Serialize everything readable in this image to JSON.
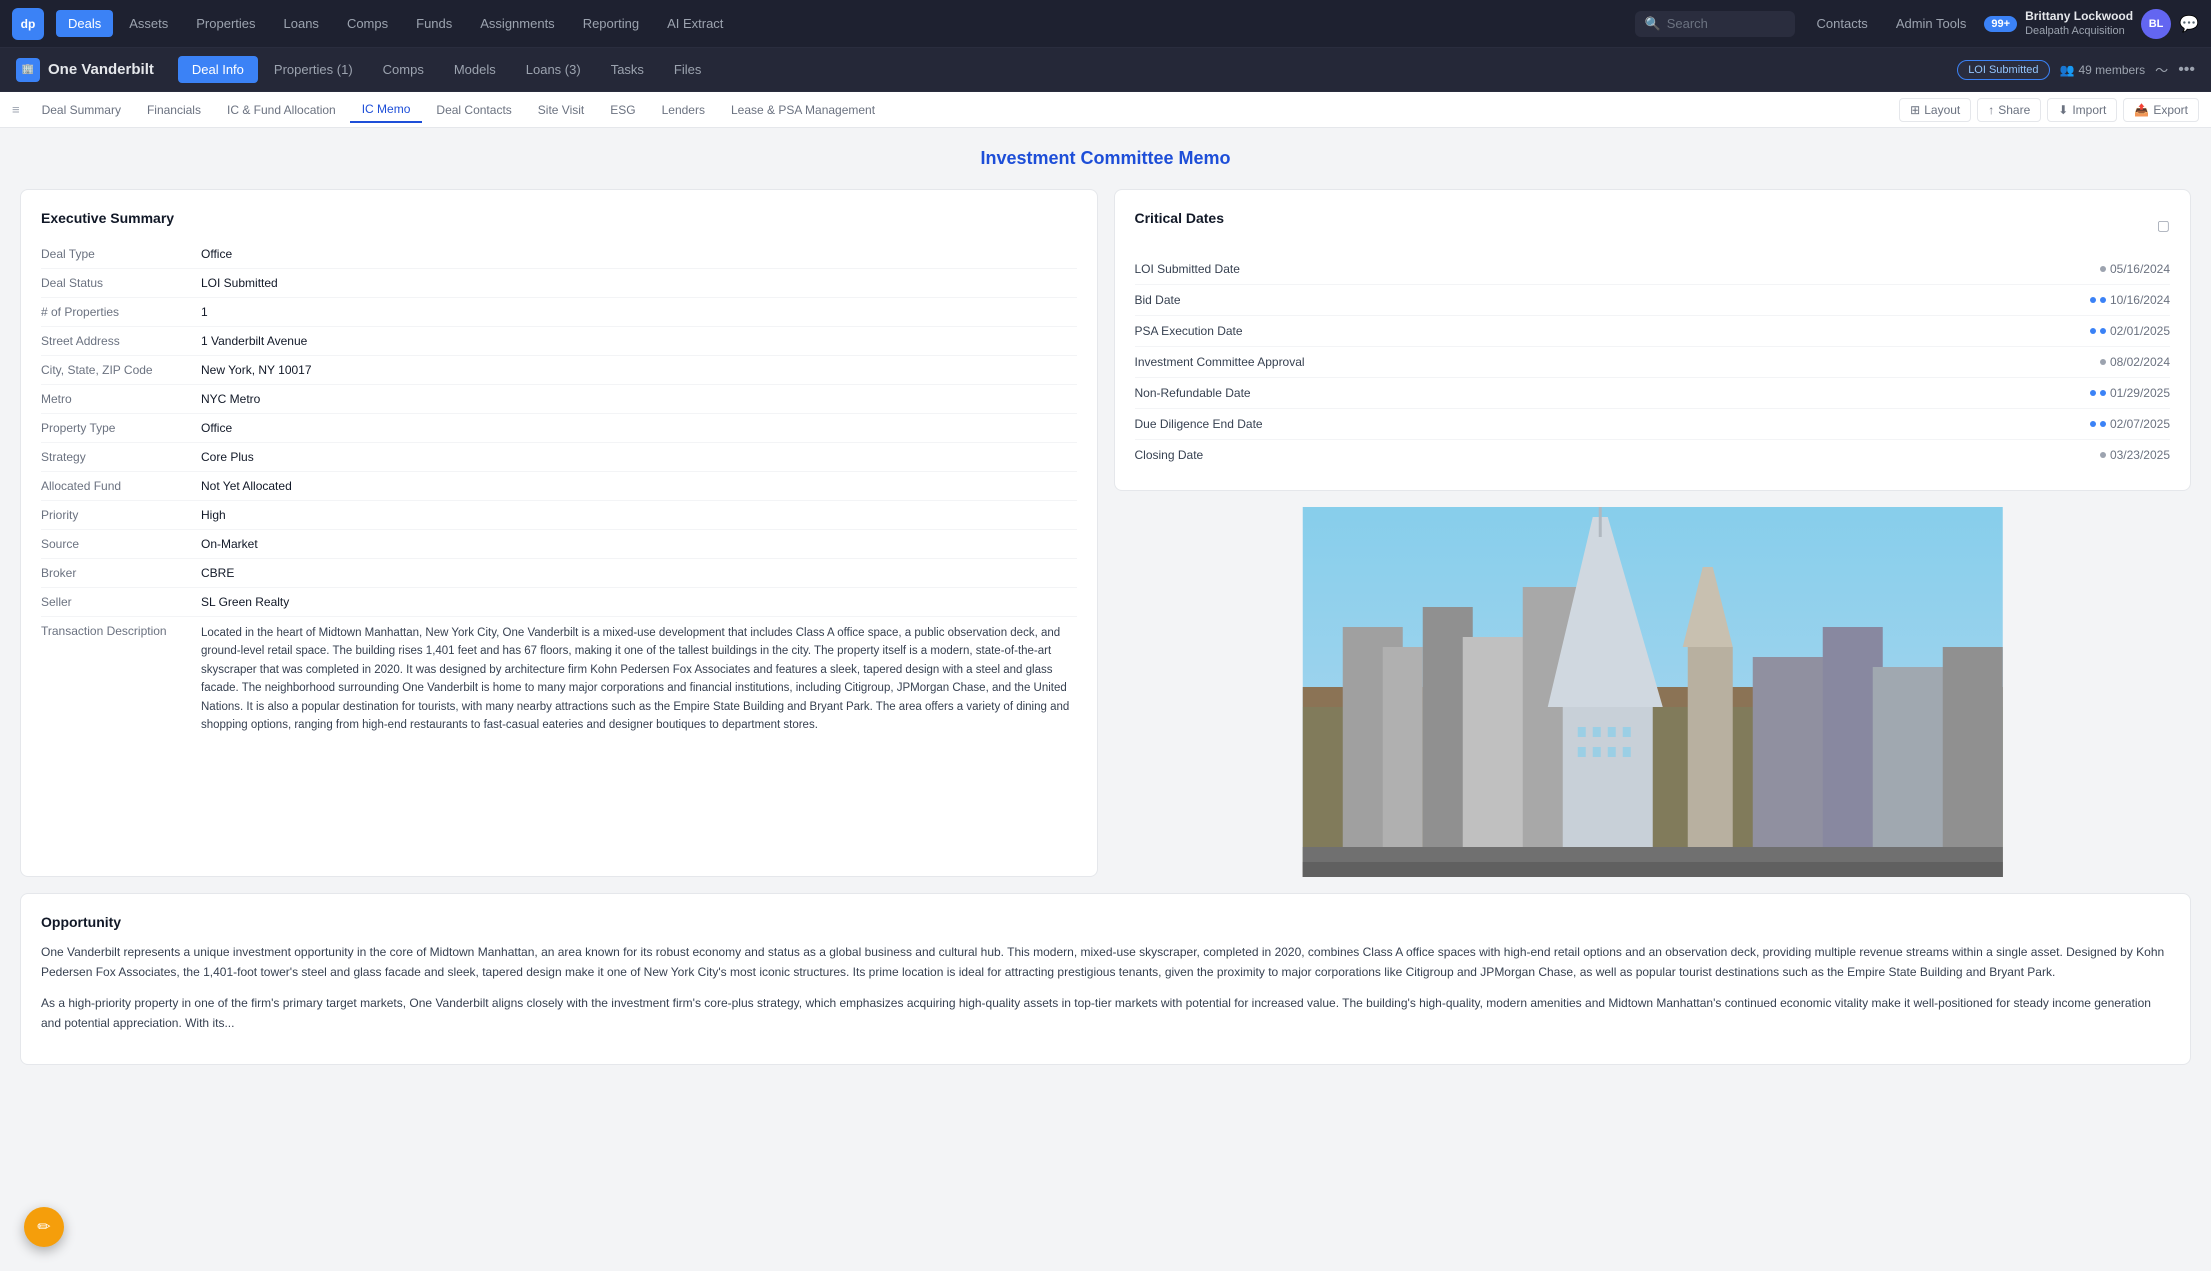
{
  "app": {
    "logo": "dp",
    "nav_items": [
      {
        "label": "Deals",
        "active": true
      },
      {
        "label": "Assets",
        "active": false
      },
      {
        "label": "Properties",
        "active": false
      },
      {
        "label": "Loans",
        "active": false
      },
      {
        "label": "Comps",
        "active": false
      },
      {
        "label": "Funds",
        "active": false
      },
      {
        "label": "Assignments",
        "active": false
      },
      {
        "label": "Reporting",
        "active": false
      },
      {
        "label": "AI Extract",
        "active": false
      }
    ],
    "search_placeholder": "Search",
    "contacts_label": "Contacts",
    "admin_tools_label": "Admin Tools",
    "notification_count": "99+",
    "user": {
      "name": "Brittany Lockwood",
      "company": "Dealpath Acquisition",
      "initials": "BL"
    }
  },
  "deal": {
    "title": "One Vanderbilt",
    "icon": "🏢",
    "status": "LOI Submitted",
    "members_count": "49 members",
    "tabs": [
      {
        "label": "Deal Info",
        "active": true
      },
      {
        "label": "Properties (1)",
        "active": false
      },
      {
        "label": "Comps",
        "active": false
      },
      {
        "label": "Models",
        "active": false
      },
      {
        "label": "Loans (3)",
        "active": false
      },
      {
        "label": "Tasks",
        "active": false
      },
      {
        "label": "Files",
        "active": false
      }
    ]
  },
  "sub_nav": {
    "tabs": [
      {
        "label": "Deal Summary",
        "active": false
      },
      {
        "label": "Financials",
        "active": false
      },
      {
        "label": "IC & Fund Allocation",
        "active": false
      },
      {
        "label": "IC Memo",
        "active": true
      },
      {
        "label": "Deal Contacts",
        "active": false
      },
      {
        "label": "Site Visit",
        "active": false
      },
      {
        "label": "ESG",
        "active": false
      },
      {
        "label": "Lenders",
        "active": false
      },
      {
        "label": "Lease & PSA Management",
        "active": false
      }
    ],
    "actions": [
      {
        "label": "Layout",
        "icon": "⊞"
      },
      {
        "label": "Share",
        "icon": "↑"
      },
      {
        "label": "Import",
        "icon": "⬇"
      },
      {
        "label": "Export",
        "icon": "📄"
      }
    ]
  },
  "page": {
    "title": "Investment Committee Memo"
  },
  "executive_summary": {
    "title": "Executive Summary",
    "fields": [
      {
        "label": "Deal Type",
        "value": "Office"
      },
      {
        "label": "Deal Status",
        "value": "LOI Submitted"
      },
      {
        "label": "# of Properties",
        "value": "1"
      },
      {
        "label": "Street Address",
        "value": "1 Vanderbilt Avenue"
      },
      {
        "label": "City, State, ZIP Code",
        "value": "New York, NY 10017"
      },
      {
        "label": "Metro",
        "value": "NYC Metro"
      },
      {
        "label": "Property Type",
        "value": "Office"
      },
      {
        "label": "Strategy",
        "value": "Core Plus"
      },
      {
        "label": "Allocated Fund",
        "value": "Not Yet Allocated"
      },
      {
        "label": "Priority",
        "value": "High"
      },
      {
        "label": "Source",
        "value": "On-Market"
      },
      {
        "label": "Broker",
        "value": "CBRE"
      },
      {
        "label": "Seller",
        "value": "SL Green Realty"
      },
      {
        "label": "Transaction Description",
        "value": "Located in the heart of Midtown Manhattan, New York City, One Vanderbilt is a mixed-use development that includes Class A office space, a public observation deck, and ground-level retail space. The building rises 1,401 feet and has 67 floors, making it one of the tallest buildings in the city. The property itself is a modern, state-of-the-art skyscraper that was completed in 2020. It was designed by architecture firm Kohn Pedersen Fox Associates and features a sleek, tapered design with a steel and glass facade. The neighborhood surrounding One Vanderbilt is home to many major corporations and financial institutions, including Citigroup, JPMorgan Chase, and the United Nations. It is also a popular destination for tourists, with many nearby attractions such as the Empire State Building and Bryant Park. The area offers a variety of dining and shopping options, ranging from high-end restaurants to fast-casual eateries and designer boutiques to department stores."
      }
    ]
  },
  "critical_dates": {
    "title": "Critical Dates",
    "dates": [
      {
        "label": "LOI Submitted Date",
        "value": "05/16/2024",
        "dot": "gray"
      },
      {
        "label": "Bid Date",
        "value": "10/16/2024",
        "dot": "blue"
      },
      {
        "label": "PSA Execution Date",
        "value": "02/01/2025",
        "dot": "blue"
      },
      {
        "label": "Investment Committee Approval",
        "value": "08/02/2024",
        "dot": "gray"
      },
      {
        "label": "Non-Refundable Date",
        "value": "01/29/2025",
        "dot": "blue"
      },
      {
        "label": "Due Diligence End Date",
        "value": "02/07/2025",
        "dot": "blue"
      },
      {
        "label": "Closing Date",
        "value": "03/23/2025",
        "dot": "gray"
      }
    ]
  },
  "opportunity": {
    "title": "Opportunity",
    "paragraphs": [
      "One Vanderbilt represents a unique investment opportunity in the core of Midtown Manhattan, an area known for its robust economy and status as a global business and cultural hub. This modern, mixed-use skyscraper, completed in 2020, combines Class A office spaces with high-end retail options and an observation deck, providing multiple revenue streams within a single asset. Designed by Kohn Pedersen Fox Associates, the 1,401-foot tower's steel and glass facade and sleek, tapered design make it one of New York City's most iconic structures. Its prime location is ideal for attracting prestigious tenants, given the proximity to major corporations like Citigroup and JPMorgan Chase, as well as popular tourist destinations such as the Empire State Building and Bryant Park.",
      "As a high-priority property in one of the firm's primary target markets, One Vanderbilt aligns closely with the investment firm's core-plus strategy, which emphasizes acquiring high-quality assets in top-tier markets with potential for increased value. The building's high-quality, modern amenities and Midtown Manhattan's continued economic vitality make it well-positioned for steady income generation and potential appreciation. With its..."
    ]
  },
  "icons": {
    "hamburger": "≡",
    "search": "🔍",
    "chevron_down": "▾",
    "edit": "✏",
    "layout": "⊞",
    "share": "↑",
    "import": "⬇",
    "export": "📤",
    "collapse": "▢",
    "people": "👥",
    "activity": "〜",
    "more": "•••"
  }
}
